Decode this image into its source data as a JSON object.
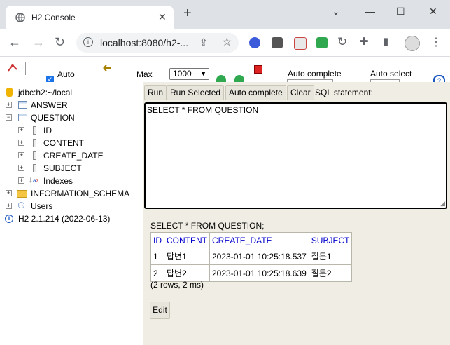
{
  "browser": {
    "tab_title": "H2 Console",
    "url": "localhost:8080/h2-..."
  },
  "toolbar": {
    "auto_commit_label": "Auto",
    "max_label": "Max",
    "max_value": "1000",
    "auto_complete_label": "Auto complete",
    "auto_select_label": "Auto select"
  },
  "tree": {
    "connection": "jdbc:h2:~/local",
    "items": [
      {
        "label": "ANSWER"
      },
      {
        "label": "QUESTION"
      },
      {
        "label": "ID"
      },
      {
        "label": "CONTENT"
      },
      {
        "label": "CREATE_DATE"
      },
      {
        "label": "SUBJECT"
      },
      {
        "label": "Indexes"
      },
      {
        "label": "INFORMATION_SCHEMA"
      },
      {
        "label": "Users"
      },
      {
        "label": "H2 2.1.214 (2022-06-13)"
      }
    ]
  },
  "buttons": {
    "run": "Run",
    "run_selected": "Run Selected",
    "auto_complete": "Auto complete",
    "clear": "Clear",
    "sql_statement_label": "SQL statement:",
    "edit": "Edit"
  },
  "sql": "SELECT * FROM QUESTION",
  "result": {
    "statement": "SELECT * FROM QUESTION;",
    "columns": [
      "ID",
      "CONTENT",
      "CREATE_DATE",
      "SUBJECT"
    ],
    "rows": [
      [
        "1",
        "답변1",
        "2023-01-01 10:25:18.537",
        "질문1"
      ],
      [
        "2",
        "답변2",
        "2023-01-01 10:25:18.639",
        "질문2"
      ]
    ],
    "row_count": "(2 rows, 2 ms)"
  },
  "colors": {
    "panel_bg": "#f0eee4",
    "header_link": "#0000cc",
    "tab_strip": "#dee1e6"
  }
}
